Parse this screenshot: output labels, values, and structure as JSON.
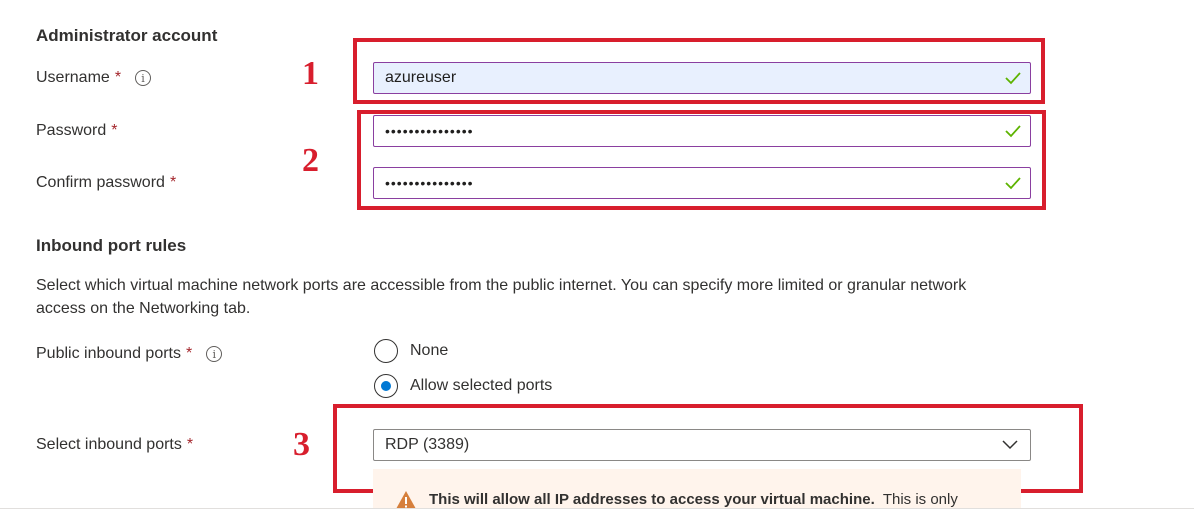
{
  "admin_section": {
    "title": "Administrator account",
    "username": {
      "label": "Username",
      "required": "*",
      "value": "azureuser",
      "valid": true
    },
    "password": {
      "label": "Password",
      "required": "*",
      "value": "•••••••••••••••",
      "valid": true
    },
    "confirm_password": {
      "label": "Confirm password",
      "required": "*",
      "value": "•••••••••••••••",
      "valid": true
    }
  },
  "inbound_section": {
    "title": "Inbound port rules",
    "description": "Select which virtual machine network ports are accessible from the public internet. You can specify more limited or granular network access on the Networking tab.",
    "public_ports": {
      "label": "Public inbound ports",
      "required": "*",
      "options": [
        {
          "label": "None",
          "selected": false
        },
        {
          "label": "Allow selected ports",
          "selected": true
        }
      ]
    },
    "select_ports": {
      "label": "Select inbound ports",
      "required": "*",
      "value": "RDP (3389)"
    },
    "warning": {
      "bold_text": "This will allow all IP addresses to access your virtual machine.",
      "text": "This is only"
    }
  },
  "callouts": [
    "1",
    "2",
    "3"
  ],
  "colors": {
    "callout": "#d81e2d",
    "focus_border": "#8a3fa0",
    "valid_check": "#5db300",
    "radio_selected": "#0078d4",
    "warning_icon": "#d67f3c",
    "warning_bg": "#fff4ec"
  },
  "icons": {
    "info": "info-icon",
    "valid": "checkmark-icon",
    "dropdown": "chevron-down-icon",
    "warning": "warning-icon"
  }
}
